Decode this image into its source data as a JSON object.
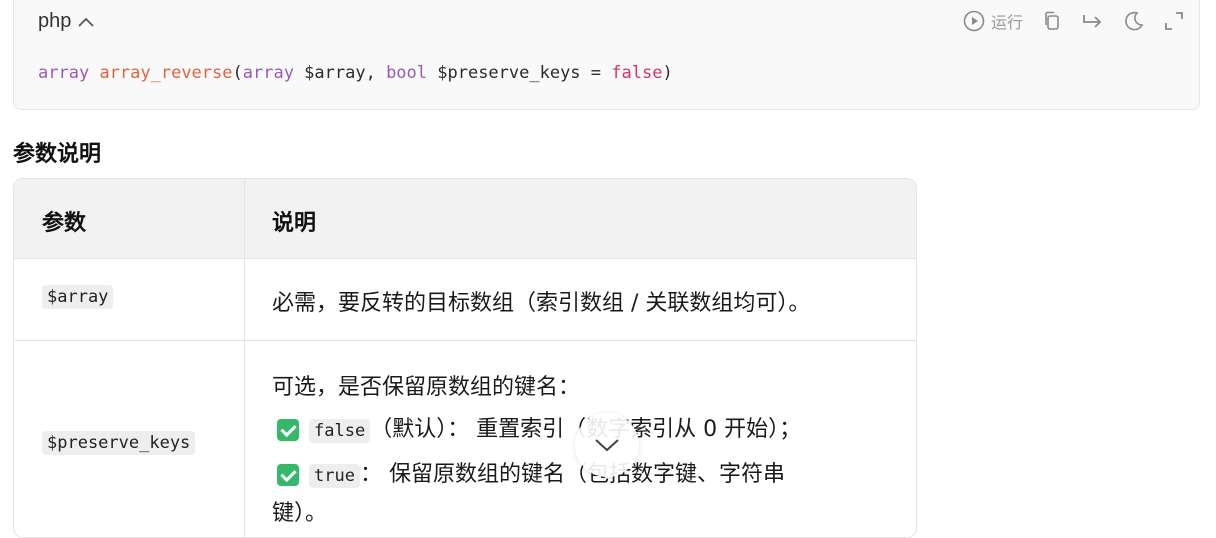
{
  "code_block": {
    "language": "php",
    "run_label": "运行",
    "signature": {
      "return_type": "array",
      "function_name": "array_reverse",
      "open_paren": "(",
      "param1_type": "array",
      "param1_name": " $array, ",
      "param2_type": "bool",
      "param2_name": " $preserve_keys = ",
      "param2_default": "false",
      "close_paren": ")"
    }
  },
  "section": {
    "title": "参数说明"
  },
  "table": {
    "headers": [
      "参数",
      "说明"
    ],
    "rows": [
      {
        "param": "$array",
        "desc": "必需，要反转的目标数组（索引数组 / 关联数组均可）。"
      },
      {
        "param": "$preserve_keys",
        "desc_intro": "可选，是否保留原数组的键名：",
        "options": [
          {
            "code": "false",
            "text": "（默认）：  重置索引（数字索引从 0 开始）；"
          },
          {
            "code": "true",
            "text": "：  保留原数组的键名（包括数字键、字符串"
          }
        ],
        "desc_cont": "键）。"
      }
    ]
  },
  "colors": {
    "keyword": "#9b59b6",
    "function": "#e0633a",
    "boolean": "#d6336c",
    "check": "#35b86a"
  }
}
